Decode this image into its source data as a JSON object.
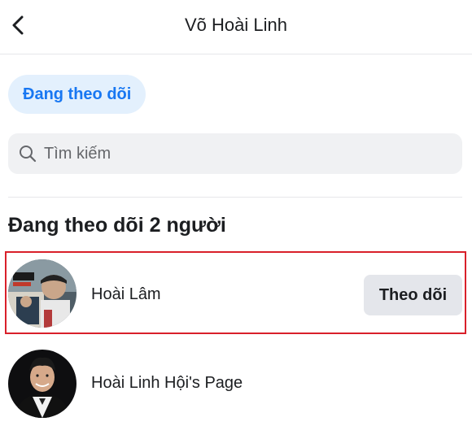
{
  "header": {
    "title": "Võ Hoài Linh",
    "back_icon": "chevron-left-icon"
  },
  "filter": {
    "label": "Đang theo dõi"
  },
  "search": {
    "placeholder": "Tìm kiếm",
    "value": "",
    "icon": "search-icon"
  },
  "section": {
    "heading": "Đang theo dõi 2 người"
  },
  "following": [
    {
      "name": "Hoài Lâm",
      "button_label": "Theo dõi",
      "highlighted": true,
      "highlight_color": "#d9202a"
    },
    {
      "name": "Hoài Linh Hội's Page"
    }
  ],
  "colors": {
    "accent": "#1877f2",
    "chip_background": "#e3f0fd",
    "button_background": "#e4e6eb"
  }
}
